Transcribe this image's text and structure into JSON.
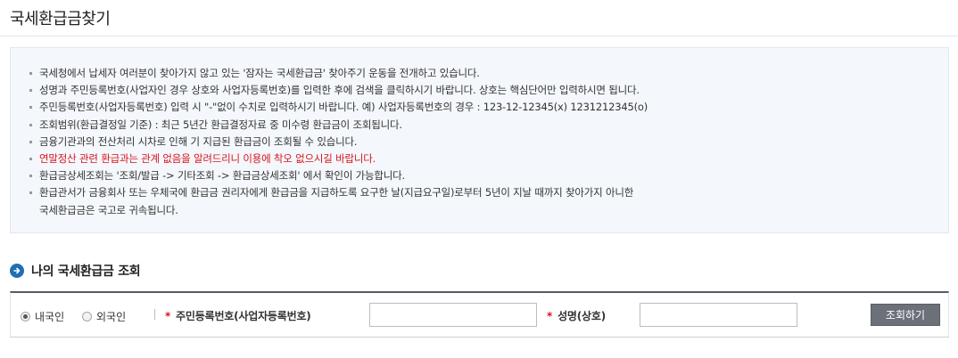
{
  "page": {
    "title": "국세환급금찾기"
  },
  "notices": [
    {
      "text": "국세청에서 납세자 여러분이 찾아가지 않고 있는 '잠자는 국세환급금' 찾아주기 운동을 전개하고 있습니다."
    },
    {
      "text": "성명과 주민등록번호(사업자인 경우 상호와 사업자등록번호)를 입력한 후에 검색을 클릭하시기 바랍니다. 상호는 핵심단어만 입력하시면 됩니다."
    },
    {
      "text": "주민등록번호(사업자등록번호) 입력 시 \"-\"없이 수치로 입력하시기 바랍니다. 예) 사업자등록번호의 경우 : 123-12-12345(x) 1231212345(o)"
    },
    {
      "text": "조회범위(환급결정일 기준) : 최근 5년간 환급결정자료 중 미수령 환급금이 조회됩니다."
    },
    {
      "text": "금융기관과의 전산처리 시차로 인해 기 지급된 환급금이 조회될 수 있습니다."
    },
    {
      "text": "연말정산 관련 환급과는 관계 없음을 알려드리니 이용에 착오 없으시길 바랍니다."
    },
    {
      "text": "환급금상세조회는 '조회/발급 -> 기타조회 -> 환급금상세조회' 에서 확인이 가능합니다."
    },
    {
      "text": "환급관서가 금융회사 또는 우체국에 환급금 권리자에게 환급금을 지급하도록 요구한 날(지급요구일)로부터 5년이 지날 때까지 찾아가지 아니한",
      "cont": "국세환급금은 국고로 귀속됩니다."
    }
  ],
  "section": {
    "heading": "나의 국세환급금 조회"
  },
  "search": {
    "radio_domestic": "내국인",
    "radio_foreign": "외국인",
    "id_label": "주민등록번호(사업자등록번호)",
    "id_value": "",
    "name_label": "성명(상호)",
    "name_value": "",
    "required_mark": "*",
    "button_label": "조회하기"
  },
  "colors": {
    "warning": "#d5161d",
    "accent": "#1f6fb5",
    "button": "#6c7078"
  }
}
